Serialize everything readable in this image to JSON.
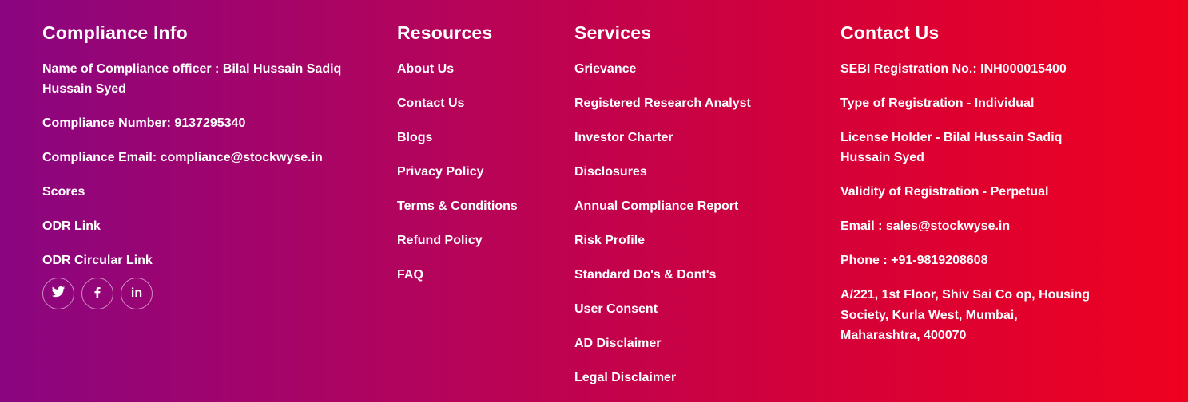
{
  "compliance": {
    "title": "Compliance Info",
    "officer": "Name of Compliance officer : Bilal Hussain Sadiq Hussain Syed",
    "number": "Compliance Number: 9137295340",
    "email": "Compliance Email: compliance@stockwyse.in",
    "scores": "Scores",
    "odr_link": "ODR Link",
    "odr_circular": "ODR Circular Link",
    "social": [
      {
        "icon": "twitter-icon"
      },
      {
        "icon": "facebook-icon"
      },
      {
        "icon": "linkedin-icon",
        "glyph": "in"
      }
    ]
  },
  "resources": {
    "title": "Resources",
    "items": [
      "About Us",
      "Contact Us",
      "Blogs",
      "Privacy Policy",
      "Terms & Conditions",
      "Refund Policy",
      "FAQ"
    ]
  },
  "services": {
    "title": "Services",
    "items": [
      "Grievance",
      "Registered Research Analyst",
      "Investor Charter",
      "Disclosures",
      "Annual Compliance Report",
      "Risk Profile",
      "Standard Do's & Dont's",
      "User Consent",
      "AD Disclaimer",
      "Legal Disclaimer"
    ]
  },
  "contact": {
    "title": "Contact Us",
    "sebi": "SEBI Registration No.: INH000015400",
    "type": "Type of Registration - Individual",
    "holder": "License Holder - Bilal Hussain Sadiq Hussain Syed",
    "validity": "Validity of Registration - Perpetual",
    "email": "Email : sales@stockwyse.in",
    "phone": "Phone : +91-9819208608",
    "address": "A/221, 1st Floor, Shiv Sai Co op, Housing Society, Kurla West, Mumbai, Maharashtra, 400070"
  },
  "colors": {
    "gradient_start": "#8a0580",
    "gradient_end": "#ef0120",
    "text": "#ffffff"
  }
}
